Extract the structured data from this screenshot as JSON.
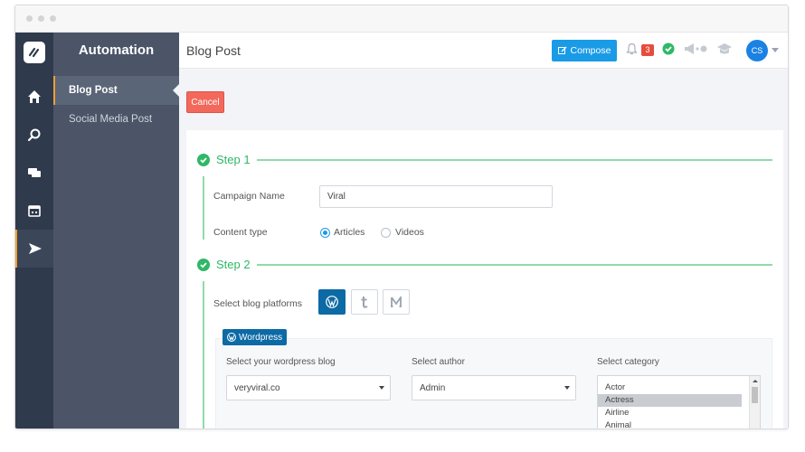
{
  "app": {
    "sidebar_title": "Automation",
    "sidebar_items": [
      {
        "label": "Blog Post",
        "active": true
      },
      {
        "label": "Social Media Post",
        "active": false
      }
    ]
  },
  "nav_icons": [
    "logo-icon",
    "home-icon",
    "search-icon",
    "chat-icon",
    "calendar-icon",
    "send-icon"
  ],
  "header": {
    "title": "Blog Post",
    "compose_label": "Compose",
    "notification_count": "3",
    "avatar_initials": "CS"
  },
  "actions": {
    "cancel_label": "Cancel"
  },
  "step1": {
    "label": "Step 1",
    "campaign_name_label": "Campaign Name",
    "campaign_name_value": "Viral",
    "content_type_label": "Content type",
    "content_types": [
      {
        "label": "Articles",
        "selected": true
      },
      {
        "label": "Videos",
        "selected": false
      }
    ]
  },
  "step2": {
    "label": "Step 2",
    "platforms_label": "Select blog platforms",
    "platforms": [
      {
        "name": "wordpress-icon",
        "selected": true
      },
      {
        "name": "tumblr-icon",
        "selected": false
      },
      {
        "name": "medium-icon",
        "selected": false
      }
    ],
    "wordpress_tag": "Wordpress",
    "blog_label": "Select your wordpress blog",
    "blog_value": "veryviral.co",
    "author_label": "Select author",
    "author_value": "Admin",
    "category_label": "Select category",
    "categories": [
      "Actor",
      "Actress",
      "Airline",
      "Animal"
    ],
    "selected_category": "Actress"
  },
  "colors": {
    "accent": "#1a9be6",
    "success": "#2eb867",
    "danger": "#f2695c",
    "sidebar": "#4b5567",
    "iconbar": "#2f3a4c",
    "highlight": "#f0a030"
  }
}
